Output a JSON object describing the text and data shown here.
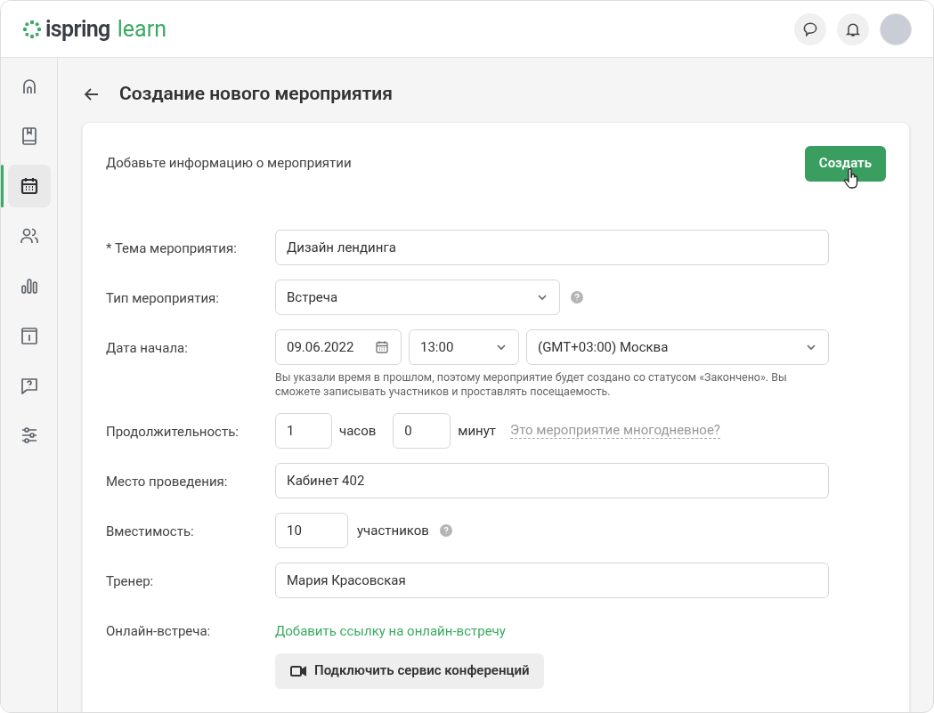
{
  "header": {
    "logo": {
      "brand": "ispring",
      "product": "learn"
    }
  },
  "sidebar": {
    "items": [
      {
        "selected": false
      },
      {
        "selected": false
      },
      {
        "selected": true
      },
      {
        "selected": false
      },
      {
        "selected": false
      },
      {
        "selected": false
      },
      {
        "selected": false
      },
      {
        "selected": false
      }
    ]
  },
  "page": {
    "title": "Создание нового мероприятия"
  },
  "card": {
    "subtitle": "Добавьте информацию о мероприятии",
    "create_button": "Создать"
  },
  "form": [
    {
      "kind": "text",
      "label": "* Тема мероприятия:",
      "value": "Дизайн лендинга"
    },
    {
      "kind": "select",
      "label": "Тип мероприятия:",
      "value": "Встреча"
    },
    {
      "kind": "datetime",
      "label": "Дата начала:",
      "date": "09.06.2022",
      "time": "13:00",
      "timezone": "(GMT+03:00) Москва",
      "note": "Вы указали время в прошлом, поэтому мероприятие будет создано со статусом «Закончено». Вы сможете записывать участников и проставлять посещаемость."
    },
    {
      "kind": "duration",
      "label": "Продолжительность:",
      "hours": "1",
      "hours_unit": "часов",
      "minutes": "0",
      "minutes_unit": "минут",
      "link": "Это мероприятие многодневное?"
    },
    {
      "kind": "text",
      "label": "Место проведения:",
      "value": "Кабинет 402"
    },
    {
      "kind": "capacity",
      "label": "Вместимость:",
      "value": "10",
      "unit": "участников"
    },
    {
      "kind": "text",
      "label": "Тренер:",
      "value": "Мария Красовская"
    },
    {
      "kind": "online",
      "label": "Онлайн-встреча:",
      "link": "Добавить ссылку на онлайн-встречу",
      "button": "Подключить сервис конференций"
    }
  ]
}
